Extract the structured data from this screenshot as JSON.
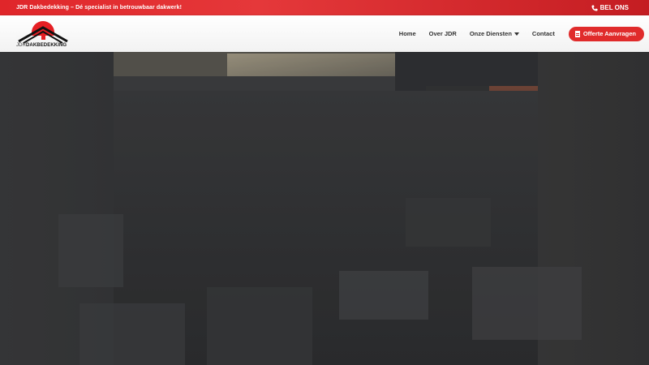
{
  "topbar": {
    "tagline": "JDR Dakbedekking – Dé specialist in betrouwbaar dakwerk!",
    "call_label": "BEL ONS",
    "call_icon": "phone-icon"
  },
  "logo": {
    "text_part1": "JDR",
    "text_part2": "DAKBEDEKKING"
  },
  "nav": {
    "items": [
      {
        "label": "Home"
      },
      {
        "label": "Over JDR"
      },
      {
        "label": "Onze Diensten"
      },
      {
        "label": "Contact"
      }
    ],
    "quote_button": "Offerte Aanvragen",
    "quote_icon": "document-icon"
  },
  "colors": {
    "brand_red": "#e02b2b",
    "header_bg": "#ffffff"
  }
}
